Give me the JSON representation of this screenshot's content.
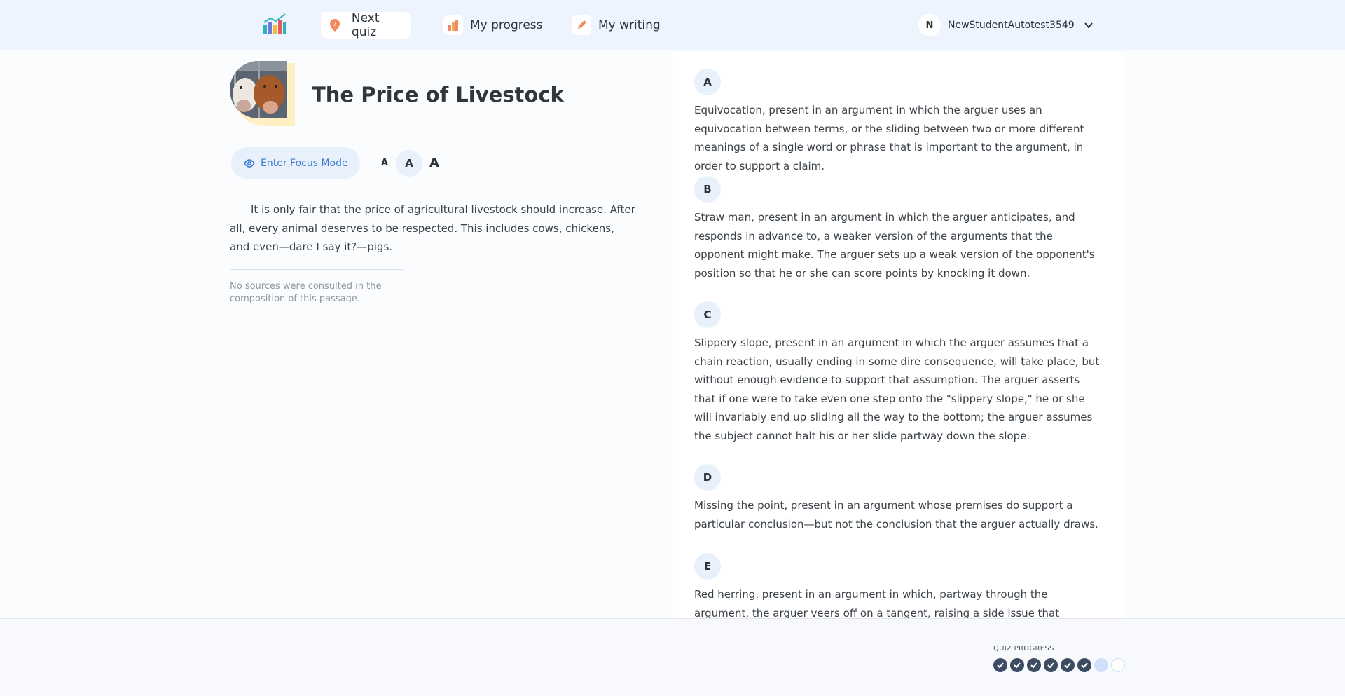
{
  "nav": {
    "logo_icon": "chart-logo-icon",
    "next_quiz": "Next quiz",
    "my_progress": "My progress",
    "my_writing": "My writing"
  },
  "user": {
    "initial": "N",
    "name": "NewStudentAutotest3549"
  },
  "passage": {
    "title": "The Price of Livestock",
    "focus_mode": "Enter Focus Mode",
    "font_sizes": [
      "A",
      "A",
      "A"
    ],
    "body": "It is only fair that the price of agricultural livestock should increase. After all, every animal deserves to be respected. This includes cows, chickens, and even—dare I say it?—pigs.",
    "sources": "No sources were consulted in the composition of this passage."
  },
  "choices": [
    {
      "letter": "A",
      "text": "Equivocation, present in an argument in which the arguer uses an equivocation between terms, or the sliding between two or more different meanings of a single word or phrase that is important to the argument, in order to support a claim."
    },
    {
      "letter": "B",
      "text": "Straw man, present in an argument in which the arguer anticipates, and responds in advance to, a weaker version of the arguments that the opponent might make. The arguer sets up a weak version of the opponent's position so that he or she can score points by knocking it down."
    },
    {
      "letter": "C",
      "text": "Slippery slope, present in an argument in which the arguer assumes that a chain reaction, usually ending in some dire consequence, will take place, but without enough evidence to support that assumption. The arguer asserts that if one were to take even one step onto the \"slippery slope,\" he or she will invariably end up sliding all the way to the bottom; the arguer assumes the subject cannot halt his or her slide partway down the slope."
    },
    {
      "letter": "D",
      "text": "Missing the point, present in an argument whose premises do support a particular conclusion—but not the conclusion that the arguer actually draws."
    },
    {
      "letter": "E",
      "text": "Red herring, present in an argument in which, partway through the argument, the arguer veers off on a tangent, raising a side issue that distracts the opponent"
    }
  ],
  "quiz_progress": {
    "label": "QUIZ PROGRESS",
    "total": 8,
    "completed": 6,
    "current": 7
  },
  "colors": {
    "accent": "#3a7bd5",
    "nav_bg": "#edf4fd",
    "done_dot": "#3d4c63"
  }
}
